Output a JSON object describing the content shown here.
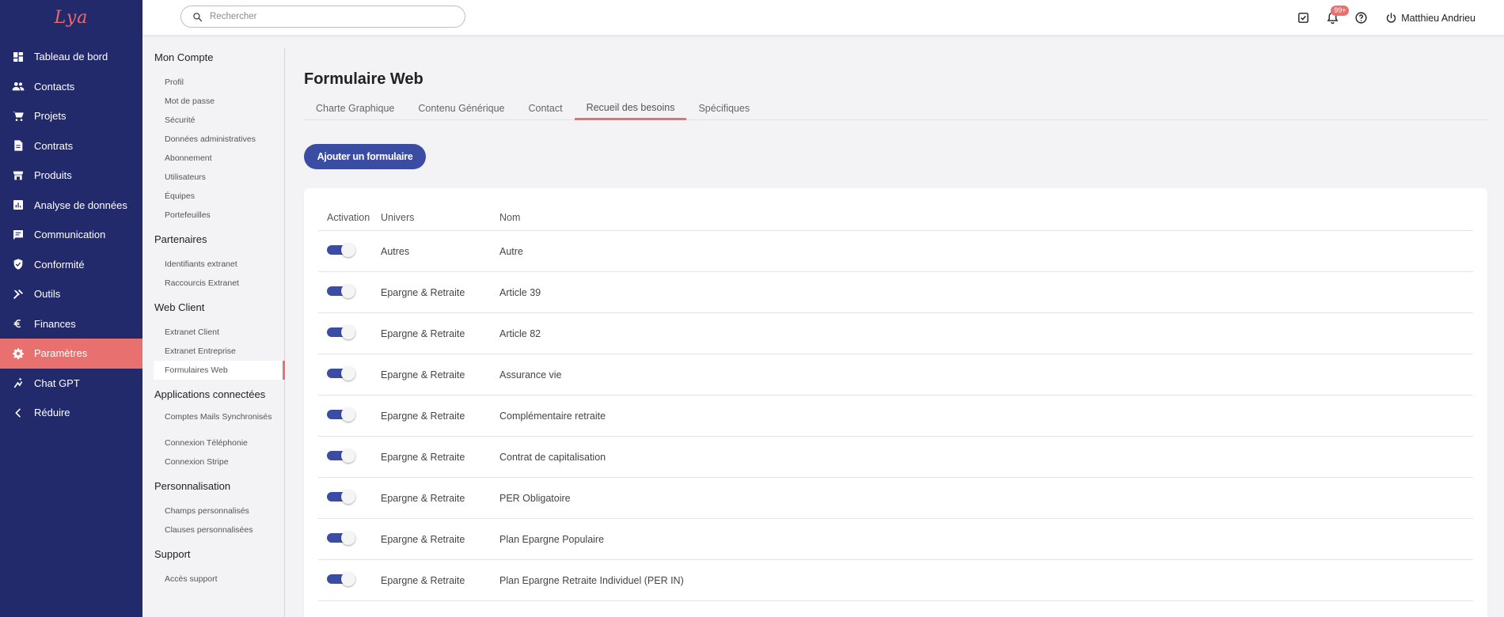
{
  "logo": {
    "text": "Lya"
  },
  "nav": {
    "items": [
      {
        "label": "Tableau de bord",
        "icon": "dashboard-icon"
      },
      {
        "label": "Contacts",
        "icon": "people-icon"
      },
      {
        "label": "Projets",
        "icon": "cart-icon"
      },
      {
        "label": "Contrats",
        "icon": "document-icon"
      },
      {
        "label": "Produits",
        "icon": "store-icon"
      },
      {
        "label": "Analyse de données",
        "icon": "chart-icon"
      },
      {
        "label": "Communication",
        "icon": "chat-icon"
      },
      {
        "label": "Conformité",
        "icon": "shield-icon"
      },
      {
        "label": "Outils",
        "icon": "tools-icon"
      },
      {
        "label": "Finances",
        "icon": "euro-icon"
      },
      {
        "label": "Paramètres",
        "icon": "gear-icon"
      },
      {
        "label": "Chat GPT",
        "icon": "assistant-icon"
      },
      {
        "label": "Réduire",
        "icon": "chevron-left-icon"
      }
    ],
    "active_index": 10
  },
  "topbar": {
    "search_placeholder": "Rechercher",
    "notification_badge": "99+",
    "user_name": "Matthieu Andrieu"
  },
  "submenu": {
    "groups": [
      {
        "title": "Mon Compte",
        "items": [
          "Profil",
          "Mot de passe",
          "Sécurité",
          "Données administratives",
          "Abonnement",
          "Utilisateurs",
          "Équipes",
          "Portefeuilles"
        ]
      },
      {
        "title": "Partenaires",
        "items": [
          "Identifiants extranet",
          "Raccourcis Extranet"
        ]
      },
      {
        "title": "Web Client",
        "items": [
          "Extranet Client",
          "Extranet Entreprise",
          "Formulaires Web"
        ]
      },
      {
        "title": "Applications connectées",
        "items": [
          "Comptes Mails Synchronisés",
          "Connexion Téléphonie",
          "Connexion Stripe"
        ]
      },
      {
        "title": "Personnalisation",
        "items": [
          "Champs personnalisés",
          "Clauses personnalisées"
        ]
      },
      {
        "title": "Support",
        "items": [
          "Accès support"
        ]
      }
    ],
    "active_item": "Formulaires Web"
  },
  "main": {
    "title": "Formulaire Web",
    "tabs": [
      "Charte Graphique",
      "Contenu Générique",
      "Contact",
      "Recueil des besoins",
      "Spécifiques"
    ],
    "active_tab_index": 3,
    "add_button": "Ajouter un formulaire",
    "table": {
      "headers": [
        "Activation",
        "Univers",
        "Nom"
      ],
      "rows": [
        {
          "active": true,
          "univers": "Autres",
          "nom": "Autre"
        },
        {
          "active": true,
          "univers": "Epargne & Retraite",
          "nom": "Article 39"
        },
        {
          "active": true,
          "univers": "Epargne & Retraite",
          "nom": "Article 82"
        },
        {
          "active": true,
          "univers": "Epargne & Retraite",
          "nom": "Assurance vie"
        },
        {
          "active": true,
          "univers": "Epargne & Retraite",
          "nom": "Complémentaire retraite"
        },
        {
          "active": true,
          "univers": "Epargne & Retraite",
          "nom": "Contrat de capitalisation"
        },
        {
          "active": true,
          "univers": "Epargne & Retraite",
          "nom": "PER Obligatoire"
        },
        {
          "active": true,
          "univers": "Epargne & Retraite",
          "nom": "Plan Epargne Populaire"
        },
        {
          "active": true,
          "univers": "Epargne & Retraite",
          "nom": "Plan Epargne Retraite Individuel (PER IN)"
        }
      ]
    }
  },
  "colors": {
    "sidebar": "#232a6b",
    "accent": "#e8706e",
    "primary": "#3b4da3"
  }
}
